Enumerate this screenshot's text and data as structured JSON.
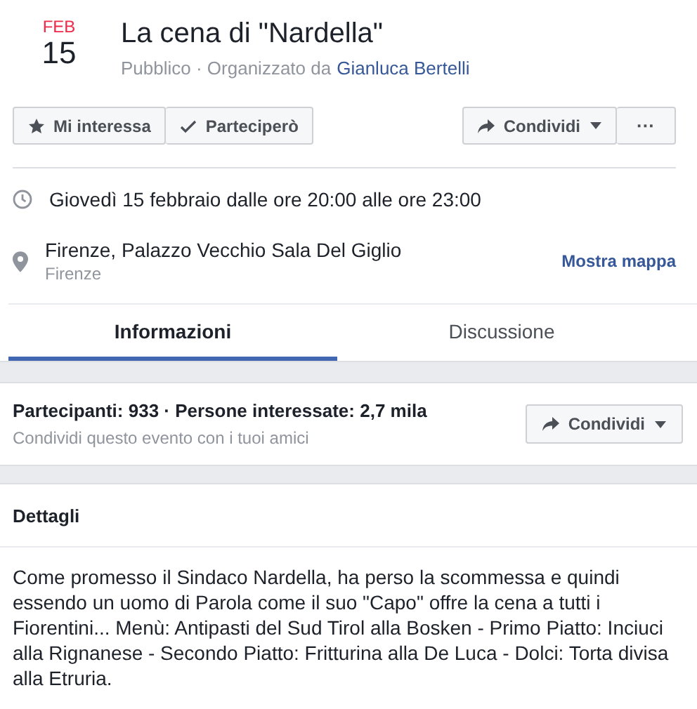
{
  "event": {
    "month": "FEB",
    "day": "15",
    "title": "La cena di \"Nardella\"",
    "privacy": "Pubblico · Organizzato da",
    "organizer": "Gianluca Bertelli"
  },
  "actions": [
    {
      "kind": "star",
      "label": "Mi interessa"
    },
    {
      "kind": "check",
      "label": "Parteciperò"
    }
  ],
  "share_button": "Condividi",
  "more_button": "···",
  "when": "Giovedì 15 febbraio dalle ore 20:00 alle ore 23:00",
  "where": {
    "place": "Firenze, Palazzo Vecchio Sala Del Giglio",
    "city": "Firenze",
    "map_link": "Mostra mappa"
  },
  "tabs": [
    {
      "label": "Informazioni",
      "selected": true
    },
    {
      "label": "Discussione",
      "selected": false
    }
  ],
  "guests": {
    "summary": "Partecipanti: 933 · Persone interessate: 2,7 mila",
    "hint": "Condividi questo evento con i tuoi amici",
    "share_button": "Condividi"
  },
  "details": {
    "heading": "Dettagli",
    "text": "Come promesso il Sindaco Nardella, ha perso la scommessa e quindi essendo un uomo di Parola come il suo \"Capo\" offre la cena a tutti i Fiorentini... Menù: Antipasti del Sud Tirol alla Bosken - Primo Piatto: Inciuci alla Rignanese - Secondo Piatto: Fritturina alla De Luca - Dolci: Torta divisa alla Etruria."
  }
}
